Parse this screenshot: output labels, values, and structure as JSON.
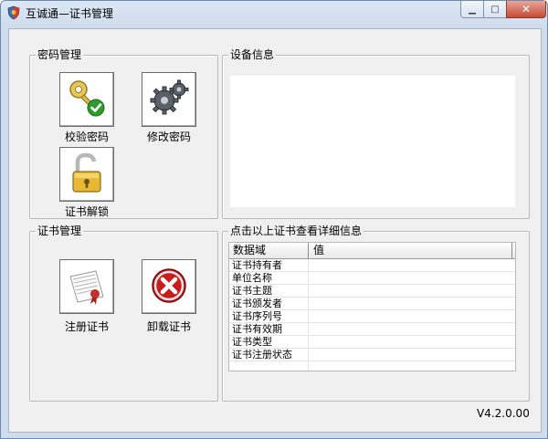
{
  "window": {
    "title": "互诚通—证书管理",
    "controls": {
      "minimize": "▁",
      "maximize": "□",
      "close": "✕"
    }
  },
  "password_group": {
    "title": "密码管理",
    "buttons": [
      {
        "label": "校验密码",
        "icon": "key-check-icon"
      },
      {
        "label": "修改密码",
        "icon": "gears-icon"
      },
      {
        "label": "证书解锁",
        "icon": "unlock-icon"
      }
    ]
  },
  "device_group": {
    "title": "设备信息"
  },
  "cert_group": {
    "title": "证书管理",
    "buttons": [
      {
        "label": "注册证书",
        "icon": "certificate-icon"
      },
      {
        "label": "卸载证书",
        "icon": "remove-icon"
      }
    ]
  },
  "details_group": {
    "title": "点击以上证书查看详细信息",
    "columns": [
      "数据域",
      "值"
    ],
    "rows": [
      {
        "field": "证书持有者",
        "value": ""
      },
      {
        "field": "单位名称",
        "value": ""
      },
      {
        "field": "证书主题",
        "value": ""
      },
      {
        "field": "证书颁发者",
        "value": ""
      },
      {
        "field": "证书序列号",
        "value": ""
      },
      {
        "field": "证书有效期",
        "value": ""
      },
      {
        "field": "证书类型",
        "value": ""
      },
      {
        "field": "证书注册状态",
        "value": ""
      }
    ]
  },
  "version": "V4.2.0.00",
  "colors": {
    "window_border": "#6d8bb0",
    "client_bg": "#f0f0f0",
    "close_button": "#c64a36",
    "check_green": "#2e9b2e",
    "remove_red": "#c71d1d"
  }
}
